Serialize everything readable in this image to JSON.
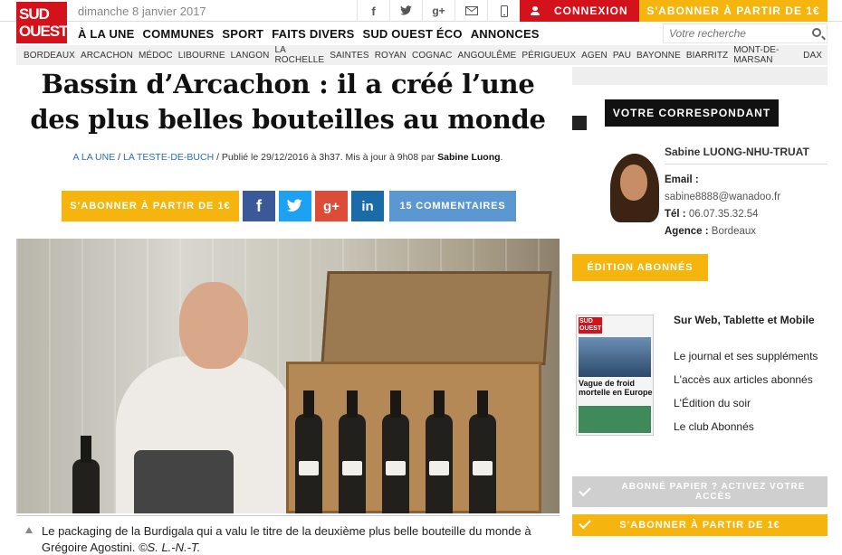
{
  "brand": {
    "logo_line1": "SUD",
    "logo_line2": "OUEST"
  },
  "topbar": {
    "date": "dimanche 8 janvier 2017",
    "social_icons": [
      "facebook-icon",
      "twitter-icon",
      "google-plus-icon",
      "mail-icon",
      "mobile-icon"
    ],
    "login_label": "CONNEXION",
    "subscribe_label": "S'ABONNER À PARTIR DE 1€"
  },
  "mainnav": {
    "items": [
      "À LA UNE",
      "COMMUNES",
      "SPORT",
      "FAITS DIVERS",
      "SUD OUEST ÉCO",
      "ANNONCES"
    ],
    "search_placeholder": "Votre recherche"
  },
  "citynav": [
    "BORDEAUX",
    "ARCACHON",
    "MÉDOC",
    "LIBOURNE",
    "LANGON",
    "LA ROCHELLE",
    "SAINTES",
    "ROYAN",
    "COGNAC",
    "ANGOULÊME",
    "PÉRIGUEUX",
    "AGEN",
    "PAU",
    "BAYONNE",
    "BIARRITZ",
    "MONT-DE-MARSAN",
    "DAX"
  ],
  "article": {
    "headline": "Bassin d’Arcachon : il a créé l’une des plus belles bouteilles au monde",
    "breadcrumb_1": "A LA UNE",
    "breadcrumb_2": "LA TESTE-DE-BUCH",
    "published": " / Publié le 29/12/2016 à 3h37. Mis à jour à 9h08 par ",
    "author": "Sabine Luong",
    "subscribe_label": "S'ABONNER À PARTIR DE 1€",
    "share": {
      "facebook": "f",
      "google": "g+",
      "linkedin": "in"
    },
    "comments_label": "15 COMMENTAIRES",
    "caption": "Le packaging de la Burdigala qui a valu le titre de la deuxième plus belle bouteille du monde à Grégoire Agostini.",
    "credit": "©S. L.-N.-T."
  },
  "sidebar": {
    "correspondent_header": "VOTRE CORRESPONDANT",
    "name": "Sabine LUONG-NHU-TRUAT",
    "email_label": "Email :",
    "email": "sabine8888@wanadoo.fr",
    "tel_label": "Tél :",
    "tel": "06.07.35.32.54",
    "agency_label": "Agence :",
    "agency": "Bordeaux",
    "edition_label": "ÉDITION ABONNÉS",
    "paper_logo": "SUD OUEST",
    "paper_headline": "Vague de froid mortelle en Europe",
    "edition_title": "Sur Web, Tablette et Mobile",
    "edition_items": [
      "Le journal et ses suppléments",
      "L'accès aux articles abonnés",
      "L'Édition du soir",
      "Le club Abonnés"
    ],
    "activate_label": "ABONNÉ PAPIER ? ACTIVEZ VOTRE ACCÈS",
    "subscribe_label": "S'ABONNER À PARTIR DE 1€"
  },
  "colors": {
    "brand_red": "#d4121b",
    "accent_yellow": "#f6b40e",
    "link_blue": "#2a6fb5",
    "comments_blue": "#5b98d1"
  }
}
